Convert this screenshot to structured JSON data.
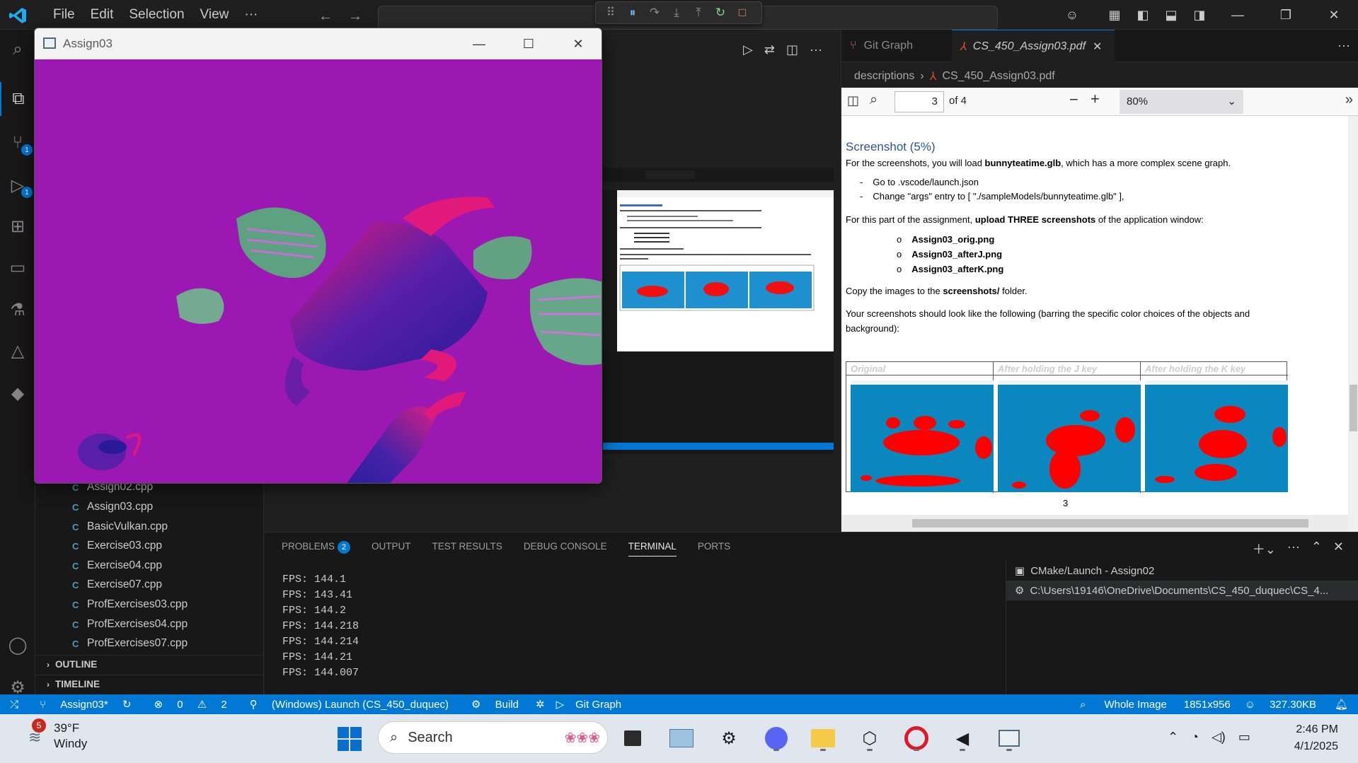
{
  "vscode": {
    "menu": [
      "File",
      "Edit",
      "Selection",
      "View",
      "···"
    ],
    "explorer_files": [
      "Assign02.cpp",
      "Assign03.cpp",
      "BasicVulkan.cpp",
      "Exercise03.cpp",
      "Exercise04.cpp",
      "Exercise07.cpp",
      "ProfExercises03.cpp",
      "ProfExercises04.cpp",
      "ProfExercises07.cpp"
    ],
    "sections": {
      "outline": "OUTLINE",
      "timeline": "TIMELINE"
    },
    "activity_badges": {
      "source_control": "1",
      "run_debug": "1"
    },
    "tabs": {
      "git_graph": "Git Graph",
      "pdf": "CS_450_Assign03.pdf"
    },
    "breadcrumb": {
      "folder": "descriptions",
      "file": "CS_450_Assign03.pdf"
    },
    "pdf_toolbar": {
      "page": "3",
      "of": "of 4",
      "zoom": "80%"
    },
    "panel": {
      "tabs": [
        "PROBLEMS",
        "OUTPUT",
        "TEST RESULTS",
        "DEBUG CONSOLE",
        "TERMINAL",
        "PORTS"
      ],
      "problems_count": "2",
      "active_tab": "TERMINAL",
      "terminal_lines": [
        "FPS: 144.1",
        "FPS: 143.41",
        "FPS: 144.2",
        "FPS: 144.218",
        "FPS: 144.214",
        "FPS: 144.21",
        "FPS: 144.007"
      ],
      "terminals": [
        "CMake/Launch - Assign02",
        "C:\\Users\\19146\\OneDrive\\Documents\\CS_450_duquec\\CS_4..."
      ]
    },
    "statusbar": {
      "branch": "Assign03*",
      "errors": "0",
      "warnings": "2",
      "launch": "(Windows) Launch (CS_450_duquec)",
      "build": "Build",
      "git_graph": "Git Graph",
      "image_scope": "Whole Image",
      "dimensions": "1851x956",
      "size": "327.30KB"
    }
  },
  "pdf_doc": {
    "heading": "Screenshot (5%)",
    "intro_pre": "For the screenshots, you will load ",
    "intro_bold": "bunnyteatime.glb",
    "intro_post": ", which has a more complex scene graph.",
    "steps": [
      "Go to .vscode/launch.json",
      "Change \"args\" entry to [ \"./sampleModels/bunnyteatime.glb\" ],"
    ],
    "part_pre": "For this part of the assignment, ",
    "part_bold": "upload THREE screenshots",
    "part_post": " of the application window:",
    "files": [
      "Assign03_orig.png",
      "Assign03_afterJ.png",
      "Assign03_afterK.png"
    ],
    "copy_pre": "Copy the images to the ",
    "copy_bold": "screenshots/",
    "copy_post": " folder.",
    "look_like": "Your screenshots should look like the following (barring the specific color choices of the objects and background):",
    "table_headers": [
      "Original",
      "After holding the J key",
      "After holding the K key"
    ],
    "page_number": "3"
  },
  "app_window": {
    "title": "Assign03",
    "background": "#9c18b3"
  },
  "taskbar": {
    "weather_temp": "39°F",
    "weather_cond": "Windy",
    "weather_badge": "5",
    "search_placeholder": "Search",
    "time": "2:46 PM",
    "date": "4/1/2025"
  }
}
